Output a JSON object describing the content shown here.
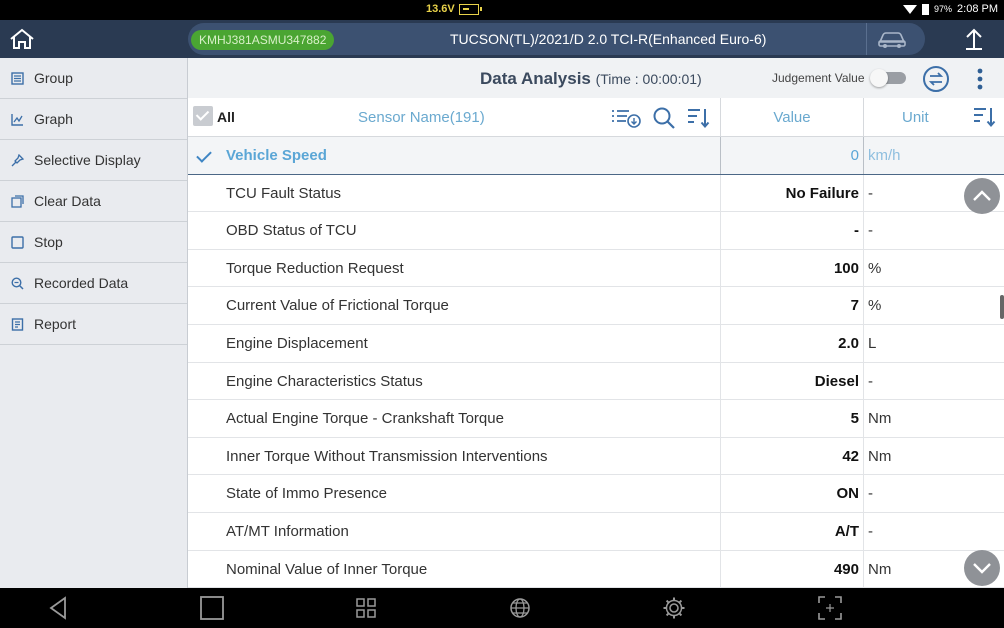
{
  "status_bar": {
    "voltage": "13.6V",
    "battery_percent": "97%",
    "clock": "2:08 PM"
  },
  "header": {
    "vin": "KMHJ381ASMU347882",
    "vehicle": "TUCSON(TL)/2021/D 2.0 TCI-R(Enhanced Euro-6)"
  },
  "sidebar": {
    "items": [
      {
        "label": "Group",
        "icon": "group-icon"
      },
      {
        "label": "Graph",
        "icon": "graph-icon"
      },
      {
        "label": "Selective Display",
        "icon": "pin-icon"
      },
      {
        "label": "Clear Data",
        "icon": "clear-icon"
      },
      {
        "label": "Stop",
        "icon": "stop-icon"
      },
      {
        "label": "Recorded Data",
        "icon": "recorded-data-icon"
      },
      {
        "label": "Report",
        "icon": "report-icon"
      }
    ]
  },
  "main": {
    "title": "Data Analysis",
    "time": "(Time : 00:00:01)",
    "judgement_label": "Judgement Value",
    "judgement_on": false
  },
  "table": {
    "all_label": "All",
    "sensor_header": "Sensor Name(191)",
    "value_header": "Value",
    "unit_header": "Unit",
    "rows": [
      {
        "name": "Vehicle Speed",
        "value": "0",
        "unit": "km/h",
        "selected": true
      },
      {
        "name": "TCU Fault Status",
        "value": "No Failure",
        "unit": "-"
      },
      {
        "name": "OBD Status of TCU",
        "value": "-",
        "unit": "-"
      },
      {
        "name": "Torque Reduction Request",
        "value": "100",
        "unit": "%"
      },
      {
        "name": "Current Value of Frictional Torque",
        "value": "7",
        "unit": "%"
      },
      {
        "name": "Engine Displacement",
        "value": "2.0",
        "unit": "L"
      },
      {
        "name": "Engine Characteristics Status",
        "value": "Diesel",
        "unit": "-"
      },
      {
        "name": "Actual Engine Torque - Crankshaft Torque",
        "value": "5",
        "unit": "Nm"
      },
      {
        "name": "Inner Torque Without Transmission Interventions",
        "value": "42",
        "unit": "Nm"
      },
      {
        "name": "State of Immo Presence",
        "value": "ON",
        "unit": "-"
      },
      {
        "name": "AT/MT Information",
        "value": "A/T",
        "unit": "-"
      },
      {
        "name": "Nominal Value of Inner Torque",
        "value": "490",
        "unit": "Nm"
      }
    ]
  },
  "colors": {
    "header_bg": "#2a3a52",
    "accent_blue": "#6aa9cf",
    "vin_green": "#4aa532",
    "sidebar_bg": "#e9ebef"
  }
}
